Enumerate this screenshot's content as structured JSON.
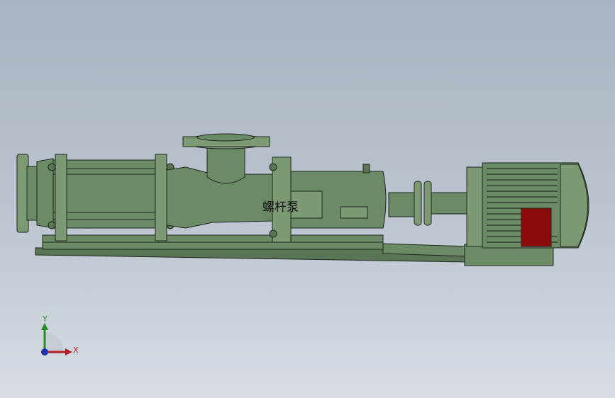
{
  "model": {
    "part_label": "螺杆泵",
    "colors": {
      "body": "#6d8a66",
      "background_top": "#a8b4c3",
      "background_bottom": "#d8dde3",
      "junction_box": "#8b0b0b"
    }
  },
  "triad": {
    "y_label": "Y",
    "x_label": "X",
    "y_color": "#2a8a2a",
    "x_color": "#b02020",
    "z_color": "#2030b0"
  }
}
